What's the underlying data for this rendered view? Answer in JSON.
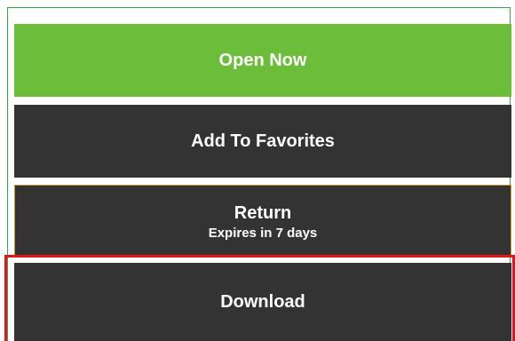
{
  "actions": {
    "open_now": "Open Now",
    "add_to_favorites": "Add To Favorites",
    "return": {
      "label": "Return",
      "expiry": "Expires in 7 days"
    },
    "download": "Download"
  },
  "colors": {
    "open_now_bg": "#6cbe3a",
    "dark_button_bg": "#333333",
    "return_border": "#c8962a",
    "panel_border": "#3aa64a",
    "highlight_border": "#e01818"
  }
}
